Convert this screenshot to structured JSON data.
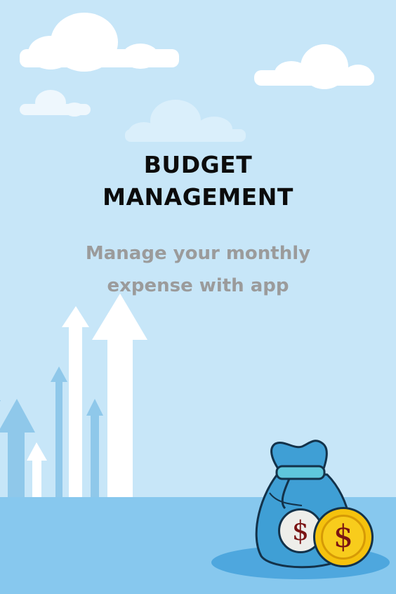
{
  "onboarding": {
    "title_line1": "BUDGET",
    "title_line2": "MANAGEMENT",
    "subtitle_line1": "Manage your monthly",
    "subtitle_line2": "expense with app"
  },
  "icons": {
    "coin_symbol_silver": "$",
    "coin_symbol_gold": "$"
  },
  "colors": {
    "sky": "#c7e6f8",
    "ground": "#87c8ee",
    "bag": "#3f9fd5",
    "tie": "#5fc7dc",
    "gold_coin": "#f5c20d",
    "dollar_red": "#7a1313"
  }
}
